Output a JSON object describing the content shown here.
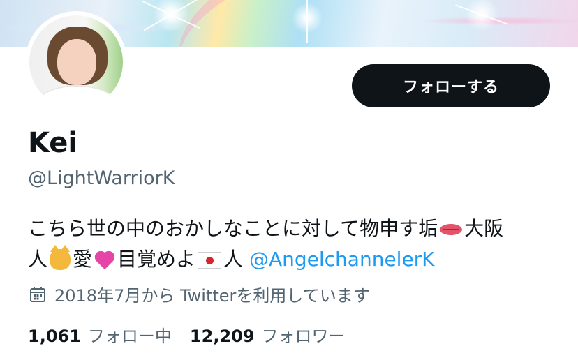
{
  "profile": {
    "name": "Kei",
    "handle": "@LightWarriorK",
    "follow_label": "フォローする",
    "bio": {
      "line1_text": "こちら世の中のおかしなことに対して物申す垢",
      "line1_tail": "大阪",
      "line2_part1": "人",
      "line2_part2": "愛",
      "line2_part3": "目覚めよ",
      "line2_part4": "人",
      "mention": "@AngelchannelerK"
    },
    "joined": "2018年7月から Twitterを利用しています",
    "stats": {
      "following_count": "1,061",
      "following_label": "フォロー中",
      "followers_count": "12,209",
      "followers_label": "フォロワー"
    }
  },
  "icons": {
    "calendar": "calendar-icon",
    "bio_emojis": [
      "lips-emoji",
      "cat-emoji",
      "sparkling-heart-emoji",
      "japan-flag-emoji"
    ]
  },
  "colors": {
    "button_bg": "#0f1419",
    "text_primary": "#0f1419",
    "text_secondary": "#536471",
    "link": "#1d9bf0"
  }
}
